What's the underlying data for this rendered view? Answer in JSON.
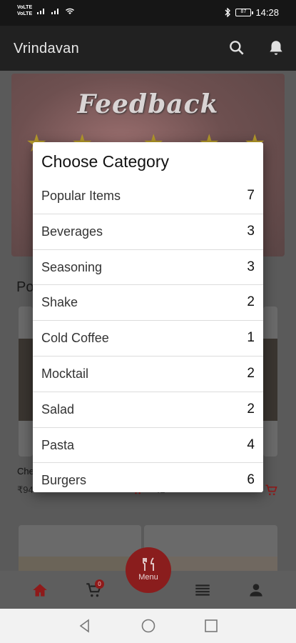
{
  "status_bar": {
    "sim1": "VoLTE",
    "sim2": "VoLTE",
    "battery_label": "87",
    "time": "14:28"
  },
  "app_bar": {
    "title": "Vrindavan",
    "search_icon": "search-icon",
    "notification_icon": "bell-icon"
  },
  "banner": {
    "title": "Feedback"
  },
  "background": {
    "section_title": "Po",
    "item1_name": "Che",
    "item1_price": "₹94",
    "item2_price": "₹1",
    "menu_label": "Menu",
    "cart_badge": "0"
  },
  "dialog": {
    "title": "Choose Category",
    "categories": [
      {
        "label": "Popular Items",
        "count": "7"
      },
      {
        "label": "Beverages",
        "count": "3"
      },
      {
        "label": "Seasoning",
        "count": "3"
      },
      {
        "label": "Shake",
        "count": "2"
      },
      {
        "label": "Cold Coffee",
        "count": "1"
      },
      {
        "label": "Mocktail",
        "count": "2"
      },
      {
        "label": "Salad",
        "count": "2"
      },
      {
        "label": "Pasta",
        "count": "4"
      },
      {
        "label": "Burgers",
        "count": "6"
      }
    ]
  },
  "colors": {
    "accent": "#d32f2f",
    "app_bar": "#212121",
    "dialog_bg": "#ffffff"
  }
}
